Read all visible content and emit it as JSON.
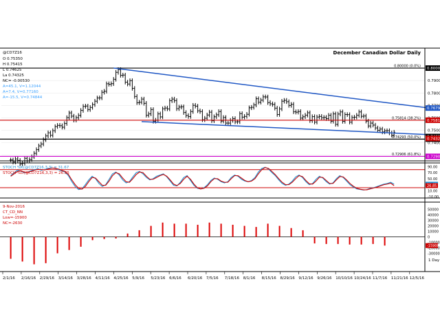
{
  "chart_data": [
    {
      "type": "ohlc",
      "title": "December Canadian Dollar Daily",
      "legend": {
        "symbol": "@CD7Z16",
        "open": "O 0.75350",
        "high": "H 0.75415",
        "close_line": "L 0.74625",
        "last": "La 0.74325",
        "net_change": "NC= -0.00530",
        "lines": [
          "A=45.1, V=1.12044",
          "A=7.4, V=0.77160",
          "A=-15.5, V=0.74844"
        ]
      },
      "ylim": [
        0.726,
        0.8155
      ],
      "price_ticks": [
        0.8,
        0.79,
        0.78,
        0.77,
        0.76,
        0.75,
        0.74,
        0.73
      ],
      "price_tick_labels": [
        "0.80000",
        "0.79000",
        "0.78000",
        "0.77000",
        "0.76000",
        "0.75000",
        "0.74000",
        "0.73000"
      ],
      "x_tick_labels": [
        "2/1/16",
        "2/16/16",
        "2/29/16",
        "3/14/16",
        "3/28/16",
        "4/11/16",
        "4/25/16",
        "5/9/16",
        "5/23/16",
        "6/6/16",
        "6/20/16",
        "7/5/16",
        "7/18/16",
        "8/1/16",
        "8/15/16",
        "8/29/16",
        "9/12/16",
        "9/26/16",
        "10/10/16",
        "10/24/16",
        "11/7/16",
        "11/21/16",
        "12/5/16"
      ],
      "axis_unit": "1 Day",
      "horizontal_lines": [
        {
          "level": 0.8,
          "label": "0.80000 (0.0%)",
          "axis_tag": "0.80000",
          "color": "#000000"
        },
        {
          "level": 0.75814,
          "label": "0.75814 (38.2%)",
          "axis_tag": "0.75814",
          "color": "#cc0000"
        },
        {
          "level": 0.74293,
          "label": "0.74293 (50.0%)",
          "axis_tag": "0.74293",
          "color": "#000000"
        },
        {
          "level": 0.72906,
          "label": "0.72906 (61.8%)",
          "axis_tag": "0.72906",
          "color": "#cc00cc"
        }
      ],
      "axis_tags": [
        {
          "value": 0.7679,
          "text": "0.76790",
          "color": "#1e56c4"
        },
        {
          "value": 0.745,
          "text": "0.74625",
          "color": "#000000"
        },
        {
          "value": 0.7435,
          "text": "0.74325",
          "color": "#cc0000"
        }
      ],
      "trendlines": [
        {
          "from": [
            48,
            0.8
          ],
          "to": [
            183,
            0.7679
          ],
          "color": "#1e56c4"
        },
        {
          "from": [
            60,
            0.757
          ],
          "to": [
            183,
            0.7465
          ],
          "color": "#1e56c4"
        }
      ],
      "bars_x": [
        4,
        5,
        6,
        7,
        8,
        9,
        10,
        11,
        12,
        13,
        14,
        15,
        16,
        17,
        18,
        19,
        20,
        21,
        22,
        23,
        24,
        25,
        26,
        27,
        28,
        29,
        30,
        31,
        32,
        33,
        34,
        35,
        36,
        37,
        38,
        39,
        40,
        41,
        42,
        43,
        44,
        45,
        46,
        47,
        48,
        49,
        50,
        51,
        52,
        53,
        54,
        55,
        56,
        57,
        58,
        59,
        60,
        61,
        62,
        63,
        64,
        65,
        66,
        67,
        68,
        69,
        70,
        71,
        72,
        73,
        74,
        75,
        76,
        77,
        78,
        79,
        80,
        81,
        82,
        83,
        84,
        85,
        86,
        87,
        88,
        89,
        90,
        91,
        92,
        93,
        94,
        95,
        96,
        97,
        98,
        99,
        100,
        101,
        102,
        103,
        104,
        105,
        106,
        107,
        108,
        109,
        110,
        111,
        112,
        113,
        114,
        115,
        116,
        117,
        118,
        119,
        120,
        121,
        122,
        123,
        124,
        125,
        126,
        127,
        128,
        129,
        130,
        131,
        132,
        133,
        134,
        135,
        136,
        137,
        138,
        139,
        140,
        141,
        142,
        143,
        144,
        145,
        146,
        147,
        148,
        149,
        150,
        151,
        152,
        153,
        154,
        155,
        156,
        157,
        158,
        159,
        160,
        161,
        162,
        163,
        164,
        165,
        166,
        167,
        168
      ],
      "bars_close": [
        0.7262,
        0.7245,
        0.727,
        0.7258,
        0.723,
        0.7235,
        0.7275,
        0.7254,
        0.7265,
        0.7288,
        0.7315,
        0.7345,
        0.7375,
        0.739,
        0.7425,
        0.7455,
        0.748,
        0.746,
        0.7497,
        0.753,
        0.754,
        0.7537,
        0.7525,
        0.7555,
        0.7602,
        0.764,
        0.7614,
        0.7582,
        0.7602,
        0.762,
        0.766,
        0.7692,
        0.7695,
        0.7667,
        0.7684,
        0.7707,
        0.7734,
        0.776,
        0.7761,
        0.7806,
        0.7814,
        0.7874,
        0.787,
        0.7875,
        0.791,
        0.7966,
        0.7988,
        0.7942,
        0.7944,
        0.7887,
        0.7872,
        0.7899,
        0.7837,
        0.7772,
        0.7722,
        0.7726,
        0.7751,
        0.7717,
        0.7621,
        0.7632,
        0.7667,
        0.7573,
        0.7581,
        0.7632,
        0.7608,
        0.7673,
        0.7679,
        0.7672,
        0.7738,
        0.7751,
        0.7739,
        0.7674,
        0.7687,
        0.7689,
        0.7643,
        0.7619,
        0.7611,
        0.7651,
        0.7701,
        0.7694,
        0.7657,
        0.7651,
        0.7585,
        0.7597,
        0.7623,
        0.7646,
        0.7577,
        0.7609,
        0.7625,
        0.7651,
        0.7574,
        0.7603,
        0.7558,
        0.7558,
        0.758,
        0.7594,
        0.7568,
        0.7569,
        0.7634,
        0.7606,
        0.7612,
        0.7629,
        0.7681,
        0.7685,
        0.7704,
        0.7754,
        0.7726,
        0.7743,
        0.7769,
        0.7768,
        0.7723,
        0.7713,
        0.7708,
        0.7678,
        0.7627,
        0.7672,
        0.7734,
        0.7741,
        0.773,
        0.77,
        0.7709,
        0.7649,
        0.7646,
        0.7651,
        0.7598,
        0.7609,
        0.7622,
        0.7641,
        0.7578,
        0.761,
        0.7566,
        0.7607,
        0.7612,
        0.7601,
        0.7604,
        0.7594,
        0.7621,
        0.7573,
        0.7632,
        0.7548,
        0.7631,
        0.7648,
        0.7572,
        0.7627,
        0.7626,
        0.7566,
        0.7603,
        0.7606,
        0.7621,
        0.7648,
        0.7613,
        0.7615,
        0.7574,
        0.7535,
        0.7558,
        0.7542,
        0.7519,
        0.75,
        0.751,
        0.7487,
        0.7496,
        0.7497,
        0.7479,
        0.7462,
        0.7485,
        0.7466,
        0.7468,
        0.7533,
        0.7433
      ],
      "bars_range": [
        0.0036,
        0.0036,
        0.0036,
        0.0036,
        0.0036,
        0.0036,
        0.0036,
        0.0036,
        0.0036,
        0.0036,
        0.0036,
        0.0036,
        0.0036,
        0.0036,
        0.0036,
        0.0036,
        0.0036,
        0.0036,
        0.0036,
        0.0036,
        0.0036,
        0.0036,
        0.0036,
        0.0036,
        0.0036,
        0.0036,
        0.0036,
        0.0036,
        0.0036,
        0.0036,
        0.0036,
        0.0036,
        0.0036,
        0.0036,
        0.0036,
        0.0036,
        0.0036,
        0.0036,
        0.0036,
        0.0036,
        0.0036,
        0.0036,
        0.0036,
        0.0036,
        0.0036,
        0.0036,
        0.0036,
        0.0036,
        0.0036,
        0.0036,
        0.0036,
        0.0036,
        0.0036,
        0.0036,
        0.0036,
        0.0036,
        0.0036,
        0.0036,
        0.0036,
        0.0036,
        0.0036,
        0.0036,
        0.0036,
        0.0036,
        0.0036,
        0.0036,
        0.0036,
        0.0036,
        0.0036,
        0.0036,
        0.0036,
        0.0036,
        0.0036,
        0.0036,
        0.0036,
        0.0036,
        0.0036,
        0.0036,
        0.0036,
        0.0036,
        0.0036,
        0.0036,
        0.0036,
        0.0036,
        0.0036,
        0.0036,
        0.0036,
        0.0036,
        0.0036,
        0.0036,
        0.0036,
        0.0036,
        0.0036,
        0.0036,
        0.0036,
        0.0036,
        0.0036,
        0.0036,
        0.0036,
        0.0036,
        0.0036,
        0.0036,
        0.0036,
        0.0036,
        0.0036,
        0.0036,
        0.0036,
        0.0036,
        0.0036,
        0.0036,
        0.0036,
        0.0036,
        0.0036,
        0.0036,
        0.0036,
        0.0036,
        0.0036,
        0.0036,
        0.0036,
        0.0036,
        0.0036,
        0.0036,
        0.0036,
        0.0036,
        0.0036,
        0.0036,
        0.0036,
        0.0036,
        0.0036,
        0.0036,
        0.0036,
        0.0036,
        0.0036,
        0.0036,
        0.0036,
        0.0036,
        0.0036,
        0.0036,
        0.0036,
        0.0036,
        0.0036,
        0.0036,
        0.0036,
        0.0036,
        0.0036,
        0.0036,
        0.0036,
        0.0036,
        0.0036,
        0.0036,
        0.0036,
        0.0036,
        0.0036,
        0.0036,
        0.0036,
        0.0036,
        0.0036,
        0.0036,
        0.0036,
        0.0036,
        0.0036,
        0.0036,
        0.0036,
        0.0036,
        0.0036,
        0.0036,
        0.0036,
        0.0036,
        0.0036,
        0.0036,
        0.0036,
        0.0036,
        0.0036
      ]
    },
    {
      "type": "line",
      "legend": [
        "STOCH %K(@CD7Z16,3,3) = 31.67",
        "STOCH %D(@CD7Z16,3,3) = 26.85"
      ],
      "ylim": [
        -12,
        100
      ],
      "ticks": [
        90,
        70,
        50,
        30,
        10,
        -10
      ],
      "tick_labels": [
        "90.00",
        "70.00",
        "50.00",
        "30.00",
        "10.00",
        "-10.00"
      ],
      "ref_lines": [
        80,
        20
      ],
      "axis_tags": [
        {
          "value": 31.67,
          "text": "31.67",
          "color": "#1f8fd0"
        },
        {
          "value": 26.85,
          "text": "26.85",
          "color": "#cc0000"
        }
      ],
      "series": [
        {
          "values": [
            60,
            70,
            78,
            75,
            70,
            72,
            76,
            80,
            82,
            78,
            80,
            84,
            86,
            84,
            80,
            76,
            72,
            60,
            40,
            24,
            14,
            16,
            30,
            46,
            58,
            50,
            34,
            24,
            30,
            48,
            66,
            72,
            62,
            46,
            36,
            40,
            56,
            70,
            74,
            66,
            54,
            46,
            50,
            58,
            62,
            66,
            56,
            42,
            28,
            26,
            38,
            54,
            60,
            44,
            28,
            18,
            16,
            20,
            30,
            44,
            52,
            48,
            40,
            36,
            40,
            54,
            62,
            58,
            48,
            42,
            40,
            44,
            54,
            72,
            84,
            88,
            82,
            70,
            60,
            46,
            34,
            28,
            32,
            42,
            56,
            62,
            54,
            40,
            30,
            34,
            48,
            58,
            52,
            40,
            32,
            36,
            50,
            60,
            54,
            42,
            30,
            22,
            16,
            14,
            12,
            14,
            18,
            20,
            24,
            28,
            32,
            34,
            38,
            31.67
          ],
          "color": "#1f8fd0"
        },
        {
          "values": [
            58,
            66,
            74,
            76,
            72,
            71,
            74,
            78,
            81,
            80,
            79,
            82,
            85,
            85,
            82,
            78,
            74,
            64,
            46,
            30,
            18,
            15,
            24,
            40,
            54,
            52,
            40,
            28,
            28,
            42,
            60,
            70,
            66,
            52,
            40,
            38,
            50,
            64,
            72,
            70,
            58,
            48,
            48,
            54,
            60,
            64,
            58,
            46,
            32,
            27,
            34,
            48,
            58,
            48,
            32,
            20,
            16,
            18,
            26,
            40,
            50,
            50,
            42,
            38,
            38,
            50,
            60,
            60,
            52,
            44,
            40,
            42,
            50,
            66,
            80,
            87,
            84,
            74,
            63,
            50,
            38,
            30,
            30,
            38,
            50,
            60,
            57,
            44,
            33,
            32,
            42,
            55,
            54,
            44,
            34,
            34,
            46,
            57,
            56,
            46,
            34,
            25,
            18,
            15,
            13,
            13,
            16,
            19,
            22,
            26,
            30,
            32,
            35,
            26.85
          ],
          "color": "#cc0000"
        }
      ]
    },
    {
      "type": "bar",
      "legend": [
        "9-Nov-2016",
        "CT_CD_NN",
        "Low=-15900",
        "NC=-2630"
      ],
      "ylim": [
        -62000,
        62000
      ],
      "ticks": [
        50000,
        40000,
        30000,
        20000,
        10000,
        0,
        -10000,
        -20000,
        -30000
      ],
      "tick_labels": [
        "50000",
        "40000",
        "30000",
        "20000",
        "10000",
        "0",
        "-10000",
        "-20000",
        "-30000"
      ],
      "axis_tags": [
        {
          "value": -15900,
          "text": "-15900",
          "color": "#cc0000"
        }
      ],
      "x": [
        4,
        9,
        14,
        19,
        24,
        29,
        34,
        39,
        44,
        49,
        54,
        59,
        64,
        69,
        74,
        79,
        84,
        89,
        94,
        99,
        104,
        109,
        114,
        119,
        124,
        129,
        134,
        139,
        144,
        149,
        154,
        159,
        164
      ],
      "values": [
        -40000,
        -45000,
        -50000,
        -48000,
        -30000,
        -24000,
        -18000,
        -6000,
        -4000,
        -3000,
        6000,
        12000,
        20000,
        26000,
        24000,
        24000,
        22000,
        26000,
        24000,
        22000,
        20000,
        18000,
        24000,
        20000,
        16000,
        12000,
        -12000,
        -13000,
        -13000,
        -14000,
        -14000,
        -13000,
        -15900
      ]
    }
  ]
}
